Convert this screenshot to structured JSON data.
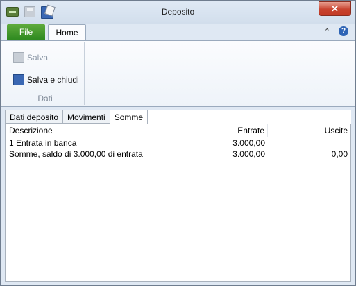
{
  "window": {
    "title": "Deposito",
    "close_glyph": "✕"
  },
  "qat": {
    "icons": [
      "app-icon",
      "save-icon",
      "save-and-close-icon"
    ]
  },
  "ribbon": {
    "tabs": {
      "file": "File",
      "home": "Home"
    },
    "minimize_glyph": "⌃",
    "help_glyph": "?",
    "group": {
      "label": "Dati",
      "save_label": "Salva",
      "save_close_label": "Salva e chiudi"
    }
  },
  "subtabs": {
    "items": [
      "Dati deposito",
      "Movimenti",
      "Somme"
    ],
    "active": "Somme"
  },
  "table": {
    "headers": [
      "Descrizione",
      "Entrate",
      "Uscite"
    ],
    "rows": [
      [
        "1 Entrata in banca",
        "3.000,00",
        ""
      ],
      [
        "Somme, saldo di 3.000,00 di entrata",
        "3.000,00",
        "0,00"
      ]
    ]
  },
  "colors": {
    "file_tab": "#3c9a2a",
    "close_button": "#c8432f",
    "ribbon_bg": "#eef3f9"
  }
}
